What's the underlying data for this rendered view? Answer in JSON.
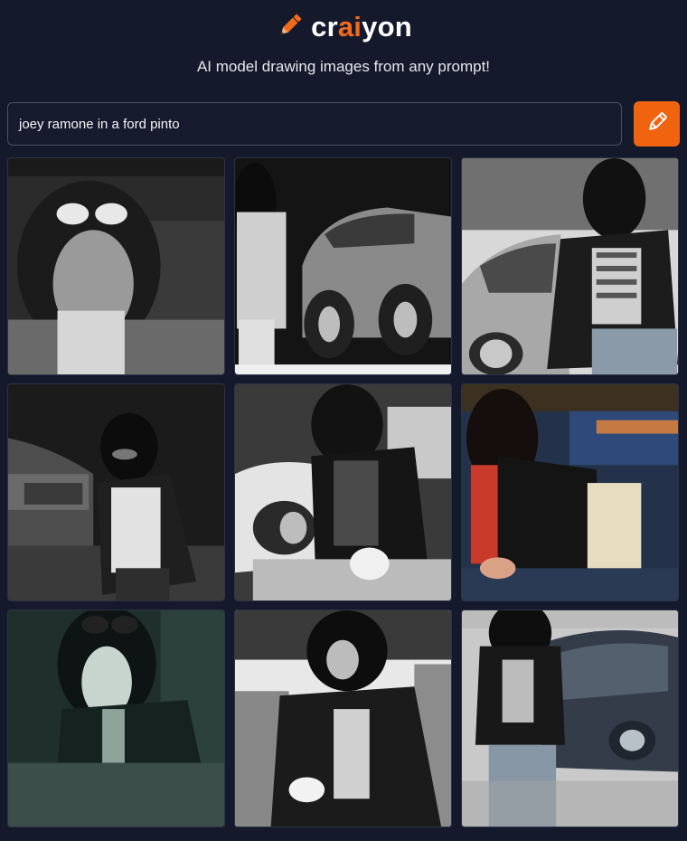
{
  "brand": {
    "name_pre": "cr",
    "name_accent": "ai",
    "name_post": "yon",
    "icon": "pencil-icon",
    "accent_color": "#f26a1b"
  },
  "tagline": "AI model drawing images from any prompt!",
  "search": {
    "value": "joey ramone in a ford pinto",
    "button_icon": "pencil-icon",
    "button_color": "#f0630f"
  },
  "results": [
    {
      "index": 1,
      "palette": "grayscale"
    },
    {
      "index": 2,
      "palette": "grayscale"
    },
    {
      "index": 3,
      "palette": "grayscale"
    },
    {
      "index": 4,
      "palette": "grayscale"
    },
    {
      "index": 5,
      "palette": "grayscale"
    },
    {
      "index": 6,
      "palette": "color"
    },
    {
      "index": 7,
      "palette": "teal"
    },
    {
      "index": 8,
      "palette": "grayscale"
    },
    {
      "index": 9,
      "palette": "grayscale"
    }
  ]
}
